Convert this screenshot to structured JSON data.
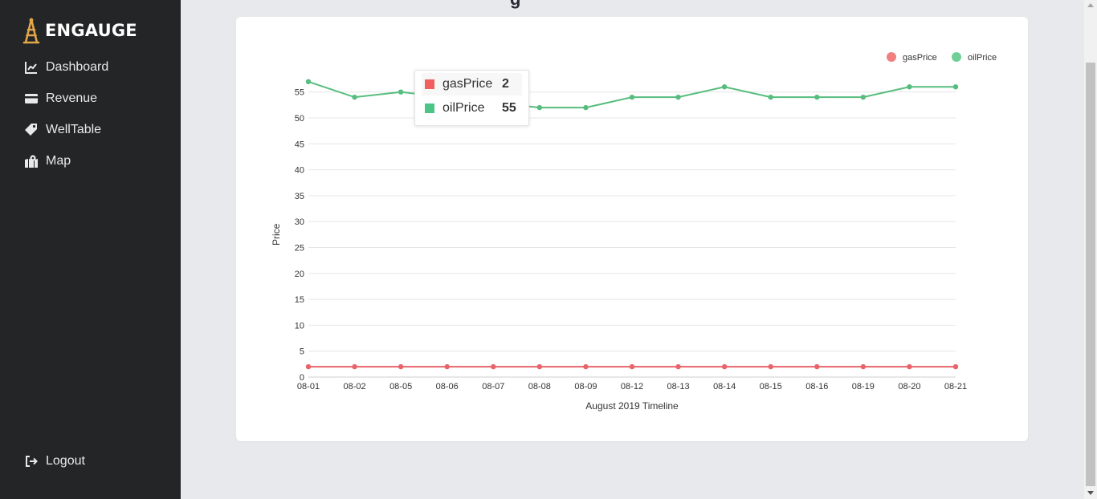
{
  "app": {
    "brand": "ENGAUGE",
    "partial_title": "g"
  },
  "sidebar": {
    "items": [
      {
        "label": "Dashboard",
        "icon": "chart-line-icon"
      },
      {
        "label": "Revenue",
        "icon": "credit-card-icon"
      },
      {
        "label": "WellTable",
        "icon": "tag-icon"
      },
      {
        "label": "Map",
        "icon": "map-marked-icon"
      }
    ],
    "logout": {
      "label": "Logout",
      "icon": "sign-out-icon"
    }
  },
  "tooltip": {
    "rows": [
      {
        "name": "gasPrice",
        "value": "2",
        "color": "#f25d5d"
      },
      {
        "name": "oilPrice",
        "value": "55",
        "color": "#4cc486"
      }
    ]
  },
  "chart_data": {
    "type": "line",
    "categories": [
      "08-01",
      "08-02",
      "08-05",
      "08-06",
      "08-07",
      "08-08",
      "08-09",
      "08-12",
      "08-13",
      "08-14",
      "08-15",
      "08-16",
      "08-19",
      "08-20",
      "08-21"
    ],
    "series": [
      {
        "name": "gasPrice",
        "color": "#e8646a",
        "values": [
          2,
          2,
          2,
          2,
          2,
          2,
          2,
          2,
          2,
          2,
          2,
          2,
          2,
          2,
          2
        ]
      },
      {
        "name": "oilPrice",
        "color": "#57bd7e",
        "values": [
          57,
          54,
          55,
          54,
          53,
          52,
          52,
          54,
          54,
          56,
          54,
          54,
          54,
          56,
          56
        ]
      }
    ],
    "xlabel": "August 2019 Timeline",
    "ylabel": "Price",
    "yticks": [
      0,
      5,
      10,
      15,
      20,
      25,
      30,
      35,
      40,
      45,
      50,
      55
    ],
    "ylim": [
      0,
      55
    ],
    "grid": true,
    "legend_position": "top-right",
    "legend": [
      {
        "name": "gasPrice",
        "color": "#f08080"
      },
      {
        "name": "oilPrice",
        "color": "#6fcf97"
      }
    ]
  }
}
